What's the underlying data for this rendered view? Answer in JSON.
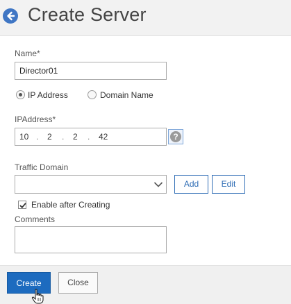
{
  "header": {
    "title": "Create Server",
    "back_icon": "back-arrow-icon"
  },
  "form": {
    "name_label": "Name*",
    "name_value": "Director01",
    "address_type": {
      "options": [
        "IP Address",
        "Domain Name"
      ],
      "selected": "IP Address"
    },
    "ip_label": "IPAddress*",
    "ip_octets": [
      "10",
      "2",
      "2",
      "42"
    ],
    "ip_separator": ".",
    "help_icon": "question-mark-icon",
    "help_glyph": "?",
    "traffic_domain_label": "Traffic Domain",
    "traffic_domain_value": "",
    "add_label": "Add",
    "edit_label": "Edit",
    "enable_label": "Enable after Creating",
    "enable_checked": true,
    "comments_label": "Comments",
    "comments_value": ""
  },
  "footer": {
    "create_label": "Create",
    "close_label": "Close"
  },
  "colors": {
    "accent": "#1d6bbf",
    "back_button": "#3f76c4",
    "header_bg": "#f2f2f2"
  }
}
